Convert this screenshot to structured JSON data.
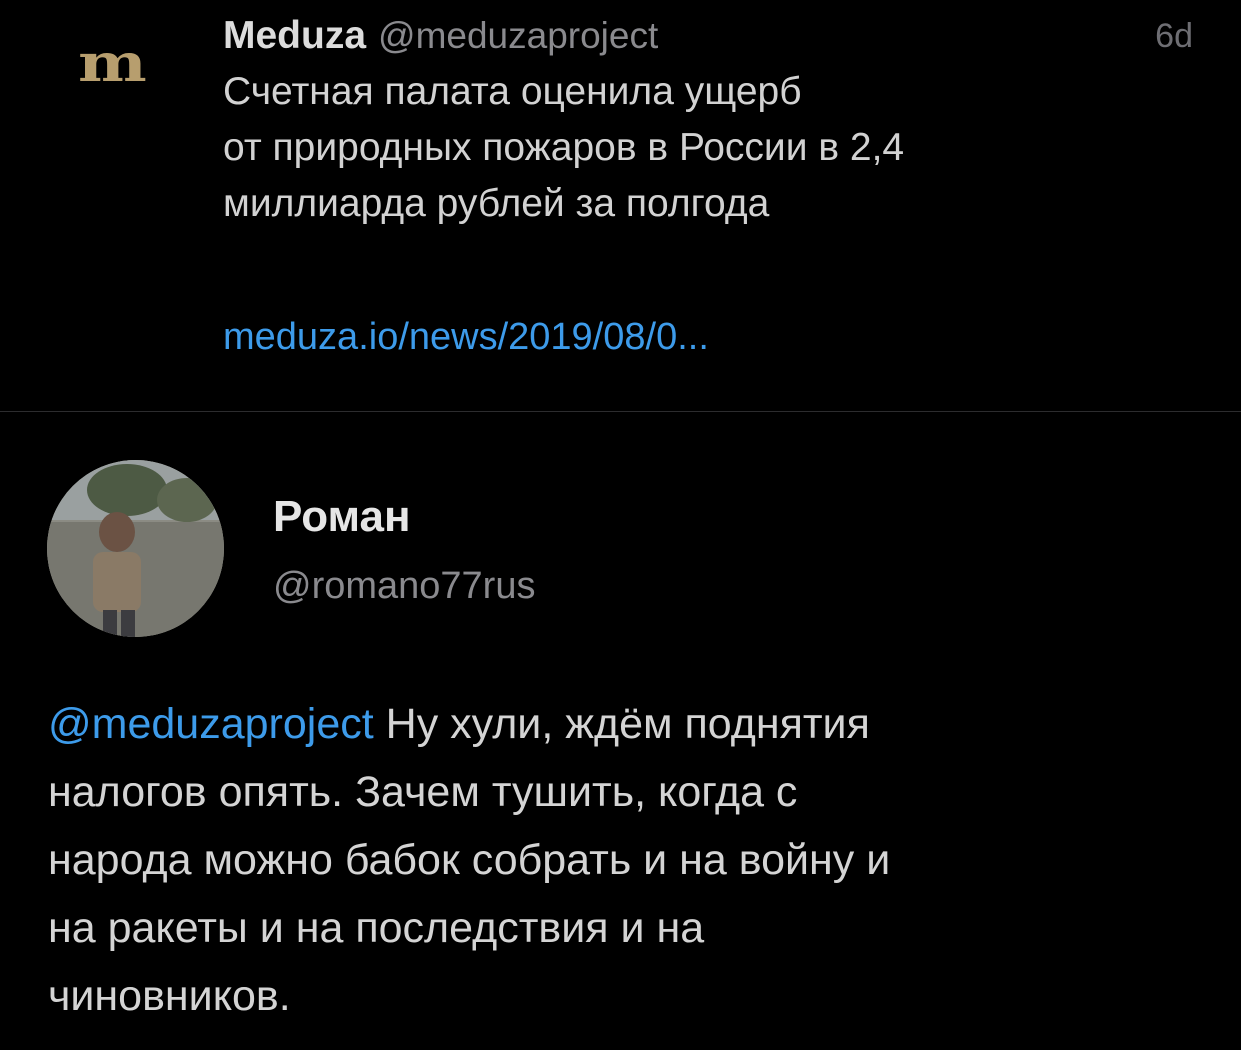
{
  "quoted_tweet": {
    "logo_text": "m",
    "author_name": "Meduza",
    "author_handle": "@meduzaproject",
    "time": "6d",
    "text_lines": [
      "Счетная палата оценила ущерб",
      "от природных пожаров в России в 2,4",
      "миллиарда рублей за полгода"
    ],
    "link": "meduza.io/news/2019/08/0..."
  },
  "reply_tweet": {
    "author_name": "Роман",
    "author_handle": "@romano77rus",
    "mention": "@meduzaproject",
    "text_lines": [
      " Ну хули, ждём поднятия",
      "налогов опять. Зачем тушить, когда с",
      "народа можно бабок собрать и на войну и",
      "на ракеты и на последствия и на",
      "чиновников."
    ]
  },
  "colors": {
    "background": "#000000",
    "link": "#3d9bea",
    "meduza_logo": "#b79e6e",
    "secondary_text": "#8a8a8e"
  }
}
